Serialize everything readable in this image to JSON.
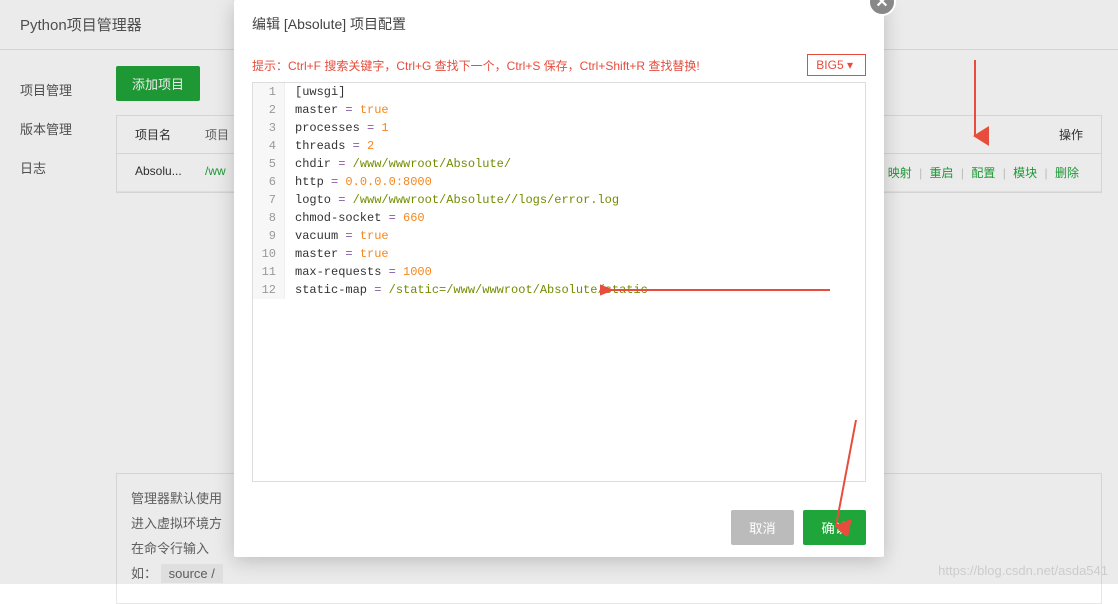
{
  "header": {
    "title": "Python项目管理器"
  },
  "sidebar": {
    "items": [
      {
        "label": "项目管理"
      },
      {
        "label": "版本管理"
      },
      {
        "label": "日志"
      }
    ]
  },
  "content": {
    "add_button": "添加项目",
    "table": {
      "headers": {
        "name": "项目名",
        "path": "项目",
        "ops": "操作"
      },
      "rows": [
        {
          "name": "Absolu...",
          "path": "/ww",
          "actions": [
            "映射",
            "重启",
            "配置",
            "模块",
            "删除"
          ]
        }
      ]
    },
    "info": {
      "line1": "管理器默认使用",
      "line2": "进入虚拟环境方",
      "line3": "在命令行输入",
      "line4_prefix": "如：",
      "line4_code": "source /"
    }
  },
  "modal": {
    "title": "编辑 [Absolute] 项目配置",
    "hint": "提示：Ctrl+F 搜索关键字，Ctrl+G 查找下一个，Ctrl+S 保存，Ctrl+Shift+R 查找替换!",
    "encoding": "BIG5",
    "code_lines": [
      {
        "n": 1,
        "raw": "[uwsgi]"
      },
      {
        "n": 2,
        "k": "master",
        "v": "true"
      },
      {
        "n": 3,
        "k": "processes",
        "v": "1"
      },
      {
        "n": 4,
        "k": "threads",
        "v": "2"
      },
      {
        "n": 5,
        "k": "chdir",
        "v": "/www/wwwroot/Absolute/"
      },
      {
        "n": 6,
        "k": "http",
        "v": "0.0.0.0:8000"
      },
      {
        "n": 7,
        "k": "logto",
        "v": "/www/wwwroot/Absolute//logs/error.log"
      },
      {
        "n": 8,
        "k": "chmod-socket",
        "v": "660"
      },
      {
        "n": 9,
        "k": "vacuum",
        "v": "true"
      },
      {
        "n": 10,
        "k": "master",
        "v": "true"
      },
      {
        "n": 11,
        "k": "max-requests",
        "v": "1000"
      },
      {
        "n": 12,
        "k": "static-map",
        "v": "/static=/www/wwwroot/Absolute/static"
      }
    ],
    "buttons": {
      "cancel": "取消",
      "confirm": "确认"
    }
  },
  "watermark": "https://blog.csdn.net/asda541"
}
